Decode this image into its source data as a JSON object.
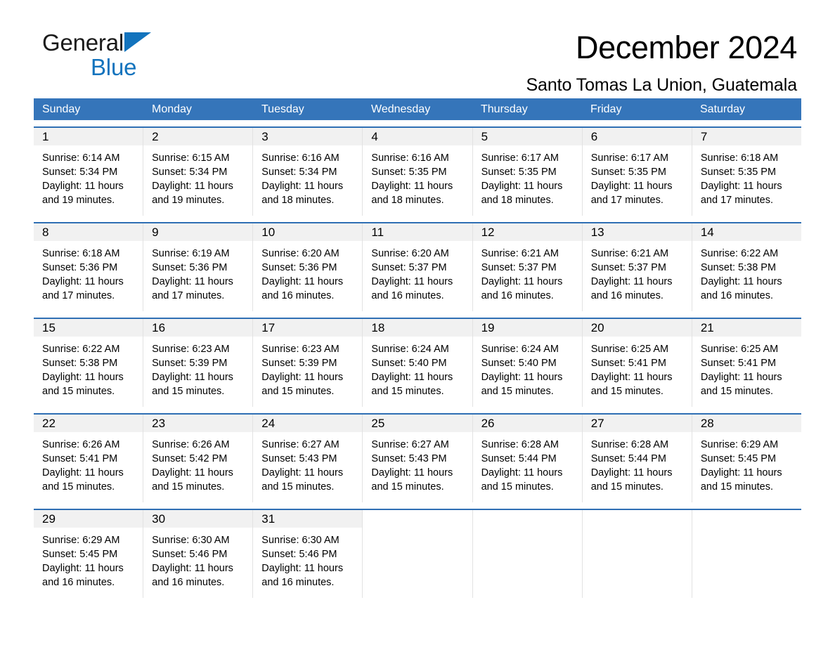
{
  "brand": {
    "name_part1": "General",
    "name_part2": "Blue",
    "triangle_color": "#1273bd",
    "logo_icon": "triangle-logo-icon"
  },
  "header": {
    "title": "December 2024",
    "subtitle": "Santo Tomas La Union, Guatemala",
    "header_bg_color": "#3575ba",
    "row_rule_color": "#2f6fb4",
    "daynum_band_color": "#f1f1f1"
  },
  "weekdays": [
    "Sunday",
    "Monday",
    "Tuesday",
    "Wednesday",
    "Thursday",
    "Friday",
    "Saturday"
  ],
  "weeks": [
    {
      "cells": [
        {
          "day": "1",
          "sunrise": "Sunrise: 6:14 AM",
          "sunset": "Sunset: 5:34 PM",
          "daylight1": "Daylight: 11 hours",
          "daylight2": "and 19 minutes."
        },
        {
          "day": "2",
          "sunrise": "Sunrise: 6:15 AM",
          "sunset": "Sunset: 5:34 PM",
          "daylight1": "Daylight: 11 hours",
          "daylight2": "and 19 minutes."
        },
        {
          "day": "3",
          "sunrise": "Sunrise: 6:16 AM",
          "sunset": "Sunset: 5:34 PM",
          "daylight1": "Daylight: 11 hours",
          "daylight2": "and 18 minutes."
        },
        {
          "day": "4",
          "sunrise": "Sunrise: 6:16 AM",
          "sunset": "Sunset: 5:35 PM",
          "daylight1": "Daylight: 11 hours",
          "daylight2": "and 18 minutes."
        },
        {
          "day": "5",
          "sunrise": "Sunrise: 6:17 AM",
          "sunset": "Sunset: 5:35 PM",
          "daylight1": "Daylight: 11 hours",
          "daylight2": "and 18 minutes."
        },
        {
          "day": "6",
          "sunrise": "Sunrise: 6:17 AM",
          "sunset": "Sunset: 5:35 PM",
          "daylight1": "Daylight: 11 hours",
          "daylight2": "and 17 minutes."
        },
        {
          "day": "7",
          "sunrise": "Sunrise: 6:18 AM",
          "sunset": "Sunset: 5:35 PM",
          "daylight1": "Daylight: 11 hours",
          "daylight2": "and 17 minutes."
        }
      ]
    },
    {
      "cells": [
        {
          "day": "8",
          "sunrise": "Sunrise: 6:18 AM",
          "sunset": "Sunset: 5:36 PM",
          "daylight1": "Daylight: 11 hours",
          "daylight2": "and 17 minutes."
        },
        {
          "day": "9",
          "sunrise": "Sunrise: 6:19 AM",
          "sunset": "Sunset: 5:36 PM",
          "daylight1": "Daylight: 11 hours",
          "daylight2": "and 17 minutes."
        },
        {
          "day": "10",
          "sunrise": "Sunrise: 6:20 AM",
          "sunset": "Sunset: 5:36 PM",
          "daylight1": "Daylight: 11 hours",
          "daylight2": "and 16 minutes."
        },
        {
          "day": "11",
          "sunrise": "Sunrise: 6:20 AM",
          "sunset": "Sunset: 5:37 PM",
          "daylight1": "Daylight: 11 hours",
          "daylight2": "and 16 minutes."
        },
        {
          "day": "12",
          "sunrise": "Sunrise: 6:21 AM",
          "sunset": "Sunset: 5:37 PM",
          "daylight1": "Daylight: 11 hours",
          "daylight2": "and 16 minutes."
        },
        {
          "day": "13",
          "sunrise": "Sunrise: 6:21 AM",
          "sunset": "Sunset: 5:37 PM",
          "daylight1": "Daylight: 11 hours",
          "daylight2": "and 16 minutes."
        },
        {
          "day": "14",
          "sunrise": "Sunrise: 6:22 AM",
          "sunset": "Sunset: 5:38 PM",
          "daylight1": "Daylight: 11 hours",
          "daylight2": "and 16 minutes."
        }
      ]
    },
    {
      "cells": [
        {
          "day": "15",
          "sunrise": "Sunrise: 6:22 AM",
          "sunset": "Sunset: 5:38 PM",
          "daylight1": "Daylight: 11 hours",
          "daylight2": "and 15 minutes."
        },
        {
          "day": "16",
          "sunrise": "Sunrise: 6:23 AM",
          "sunset": "Sunset: 5:39 PM",
          "daylight1": "Daylight: 11 hours",
          "daylight2": "and 15 minutes."
        },
        {
          "day": "17",
          "sunrise": "Sunrise: 6:23 AM",
          "sunset": "Sunset: 5:39 PM",
          "daylight1": "Daylight: 11 hours",
          "daylight2": "and 15 minutes."
        },
        {
          "day": "18",
          "sunrise": "Sunrise: 6:24 AM",
          "sunset": "Sunset: 5:40 PM",
          "daylight1": "Daylight: 11 hours",
          "daylight2": "and 15 minutes."
        },
        {
          "day": "19",
          "sunrise": "Sunrise: 6:24 AM",
          "sunset": "Sunset: 5:40 PM",
          "daylight1": "Daylight: 11 hours",
          "daylight2": "and 15 minutes."
        },
        {
          "day": "20",
          "sunrise": "Sunrise: 6:25 AM",
          "sunset": "Sunset: 5:41 PM",
          "daylight1": "Daylight: 11 hours",
          "daylight2": "and 15 minutes."
        },
        {
          "day": "21",
          "sunrise": "Sunrise: 6:25 AM",
          "sunset": "Sunset: 5:41 PM",
          "daylight1": "Daylight: 11 hours",
          "daylight2": "and 15 minutes."
        }
      ]
    },
    {
      "cells": [
        {
          "day": "22",
          "sunrise": "Sunrise: 6:26 AM",
          "sunset": "Sunset: 5:41 PM",
          "daylight1": "Daylight: 11 hours",
          "daylight2": "and 15 minutes."
        },
        {
          "day": "23",
          "sunrise": "Sunrise: 6:26 AM",
          "sunset": "Sunset: 5:42 PM",
          "daylight1": "Daylight: 11 hours",
          "daylight2": "and 15 minutes."
        },
        {
          "day": "24",
          "sunrise": "Sunrise: 6:27 AM",
          "sunset": "Sunset: 5:43 PM",
          "daylight1": "Daylight: 11 hours",
          "daylight2": "and 15 minutes."
        },
        {
          "day": "25",
          "sunrise": "Sunrise: 6:27 AM",
          "sunset": "Sunset: 5:43 PM",
          "daylight1": "Daylight: 11 hours",
          "daylight2": "and 15 minutes."
        },
        {
          "day": "26",
          "sunrise": "Sunrise: 6:28 AM",
          "sunset": "Sunset: 5:44 PM",
          "daylight1": "Daylight: 11 hours",
          "daylight2": "and 15 minutes."
        },
        {
          "day": "27",
          "sunrise": "Sunrise: 6:28 AM",
          "sunset": "Sunset: 5:44 PM",
          "daylight1": "Daylight: 11 hours",
          "daylight2": "and 15 minutes."
        },
        {
          "day": "28",
          "sunrise": "Sunrise: 6:29 AM",
          "sunset": "Sunset: 5:45 PM",
          "daylight1": "Daylight: 11 hours",
          "daylight2": "and 15 minutes."
        }
      ]
    },
    {
      "cells": [
        {
          "day": "29",
          "sunrise": "Sunrise: 6:29 AM",
          "sunset": "Sunset: 5:45 PM",
          "daylight1": "Daylight: 11 hours",
          "daylight2": "and 16 minutes."
        },
        {
          "day": "30",
          "sunrise": "Sunrise: 6:30 AM",
          "sunset": "Sunset: 5:46 PM",
          "daylight1": "Daylight: 11 hours",
          "daylight2": "and 16 minutes."
        },
        {
          "day": "31",
          "sunrise": "Sunrise: 6:30 AM",
          "sunset": "Sunset: 5:46 PM",
          "daylight1": "Daylight: 11 hours",
          "daylight2": "and 16 minutes."
        },
        {
          "day": "",
          "sunrise": "",
          "sunset": "",
          "daylight1": "",
          "daylight2": ""
        },
        {
          "day": "",
          "sunrise": "",
          "sunset": "",
          "daylight1": "",
          "daylight2": ""
        },
        {
          "day": "",
          "sunrise": "",
          "sunset": "",
          "daylight1": "",
          "daylight2": ""
        },
        {
          "day": "",
          "sunrise": "",
          "sunset": "",
          "daylight1": "",
          "daylight2": ""
        }
      ]
    }
  ]
}
